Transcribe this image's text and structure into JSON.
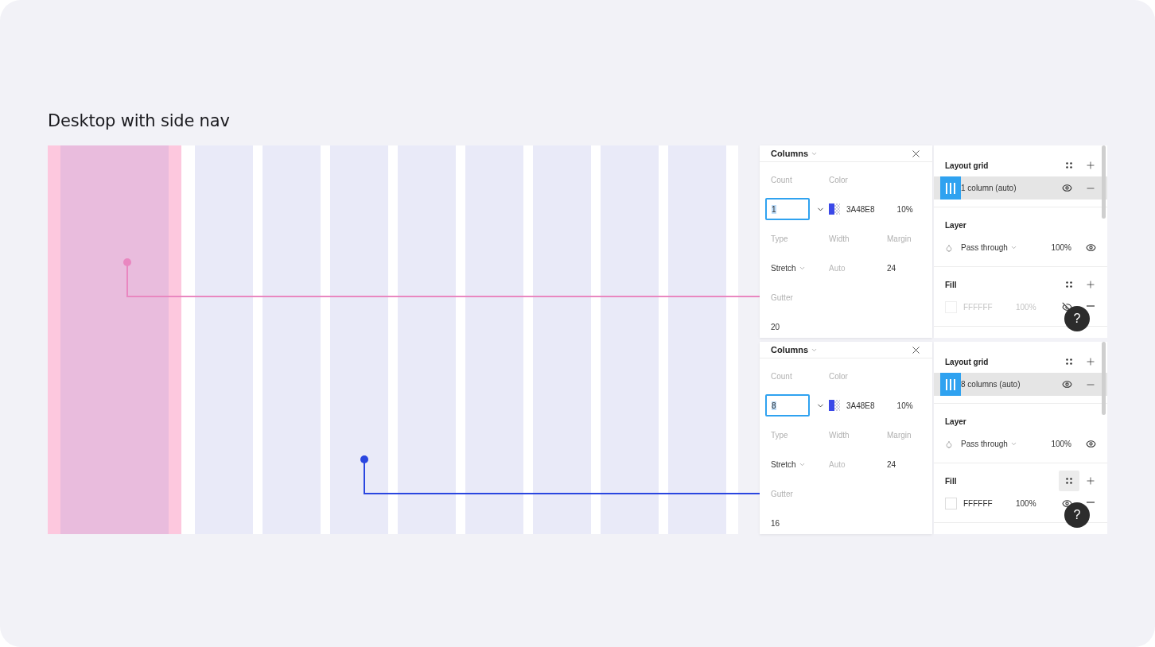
{
  "title": "Desktop with side nav",
  "panels": [
    {
      "color": "#e987c0",
      "popover": {
        "title": "Columns",
        "fields": [
          {
            "kind": "count",
            "label": "Count",
            "value": "1"
          },
          {
            "kind": "color",
            "label": "Color",
            "hex": "3A48E8",
            "opacity": "10%"
          },
          {
            "kind": "select",
            "label": "Type",
            "value": "Stretch"
          },
          {
            "kind": "muted",
            "label": "Width",
            "placeholder": "Auto"
          },
          {
            "kind": "text",
            "label": "Margin",
            "value": "24"
          },
          {
            "kind": "text",
            "label": "Gutter",
            "value": "20"
          }
        ]
      },
      "sections": [
        {
          "kind": "grid",
          "title": "Layout grid",
          "item": "1 column (auto)"
        },
        {
          "kind": "layer",
          "title": "Layer",
          "blend": "Pass through",
          "opacity": "100%"
        },
        {
          "kind": "fill",
          "title": "Fill",
          "hex": "FFFFFF",
          "opacity": "100%",
          "visible": false,
          "styles_hovered": false
        }
      ],
      "help": "?"
    },
    {
      "color": "#2a46e0",
      "popover": {
        "title": "Columns",
        "fields": [
          {
            "kind": "count",
            "label": "Count",
            "value": "8"
          },
          {
            "kind": "color",
            "label": "Color",
            "hex": "3A48E8",
            "opacity": "10%"
          },
          {
            "kind": "select",
            "label": "Type",
            "value": "Stretch"
          },
          {
            "kind": "muted",
            "label": "Width",
            "placeholder": "Auto"
          },
          {
            "kind": "text",
            "label": "Margin",
            "value": "24"
          },
          {
            "kind": "text",
            "label": "Gutter",
            "value": "16"
          }
        ]
      },
      "sections": [
        {
          "kind": "grid",
          "title": "Layout grid",
          "item": "8 columns (auto)"
        },
        {
          "kind": "layer",
          "title": "Layer",
          "blend": "Pass through",
          "opacity": "100%"
        },
        {
          "kind": "fill",
          "title": "Fill",
          "hex": "FFFFFF",
          "opacity": "100%",
          "visible": true,
          "styles_hovered": true
        }
      ],
      "help": "?"
    }
  ]
}
